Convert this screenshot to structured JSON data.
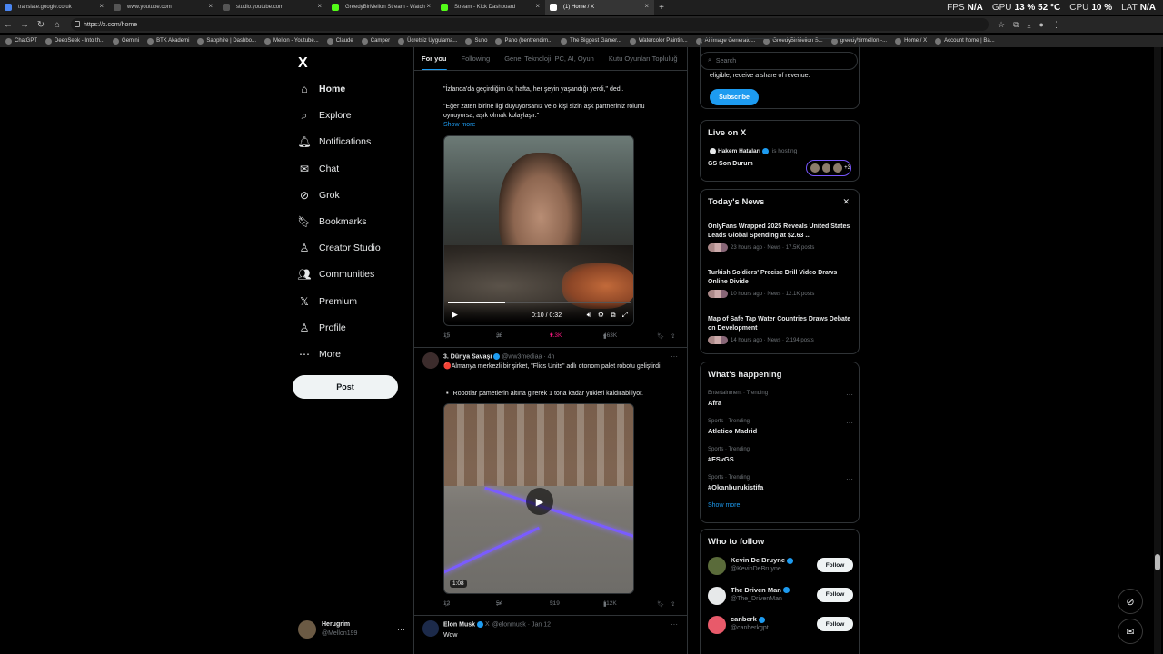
{
  "browser": {
    "tabs": [
      {
        "label": "translate.google.co.uk",
        "fav": "#4a85f0"
      },
      {
        "label": "www.youtube.com",
        "fav": "#555"
      },
      {
        "label": "studio.youtube.com",
        "fav": "#555"
      },
      {
        "label": "GreedyBirMellon Stream - Watch",
        "fav": "#53fc18"
      },
      {
        "label": "Stream - Kick Dashboard",
        "fav": "#53fc18"
      },
      {
        "label": "(1) Home / X",
        "fav": "#ffffff"
      }
    ],
    "new_tab": "+",
    "url": "https://x.com/home",
    "perf": {
      "fps_label": "FPS",
      "fps_value": "N/A",
      "gpu_label": "GPU",
      "gpu_value": "13 %  52 °C",
      "cpu_label": "CPU",
      "cpu_value": "10 %",
      "lat_label": "LAT",
      "lat_value": "N/A"
    },
    "bookmarks": [
      "ChatGPT",
      "DeepSeek - Into th...",
      "Gemini",
      "BTK Akademi",
      "Sapphire | Dashbo...",
      "Mellon - Youtube...",
      "Claude",
      "Camper",
      "Ücretsiz Uygulama...",
      "Suno",
      "Pano (bentrendim...",
      "The Biggest Gamer...",
      "Watercolor Paintin...",
      "AI Image Generato...",
      "GreedyBirMellon S...",
      "greedybirmellon -...",
      "Home / X",
      "Account home | Ba..."
    ]
  },
  "nav": {
    "logo": "X",
    "items": [
      {
        "label": "Home",
        "icon": "home-icon"
      },
      {
        "label": "Explore",
        "icon": "search-icon"
      },
      {
        "label": "Notifications",
        "icon": "bell-icon"
      },
      {
        "label": "Chat",
        "icon": "mail-icon"
      },
      {
        "label": "Grok",
        "icon": "grok-icon"
      },
      {
        "label": "Bookmarks",
        "icon": "bookmark-icon"
      },
      {
        "label": "Creator Studio",
        "icon": "creator-icon"
      },
      {
        "label": "Communities",
        "icon": "communities-icon"
      },
      {
        "label": "Premium",
        "icon": "x-icon"
      },
      {
        "label": "Profile",
        "icon": "profile-icon"
      },
      {
        "label": "More",
        "icon": "more-icon"
      }
    ],
    "post_label": "Post",
    "account": {
      "name": "Herugrim",
      "handle": "@Mellon199"
    }
  },
  "feed": {
    "tabs": [
      "For you",
      "Following",
      "Genel Teknoloji, PC, AI, Oyun",
      "Kutu Oyunları Topluluğ"
    ],
    "post1": {
      "text1": "\"İzlanda'da geçirdiğim üç hafta, her şeyin yaşandığı yerdi,\" dedi.",
      "text2": "\"Eğer zaten birine ilgi duyuyorsanız ve o kişi sizin aşk partneriniz rolünü oynuyorsa, aşık olmak kolaylaşır.\"",
      "show_more": "Show more",
      "video_time": "0:10 / 0:32",
      "video_progress": 0.31,
      "replies": "15",
      "reposts": "36",
      "likes": "1.3K",
      "views": "463K"
    },
    "post2": {
      "name": "3. Dünya Savaşı",
      "handle": "@ww3mediaa",
      "time": "4h",
      "text1": "🔴Almanya merkezli bir şirket, \"Flics Units\" adlı otonom palet robotu geliştirdi.",
      "text2": "▫️ Robotlar pametlerin altına girerek 1 tona kadar yükleri kaldırabiliyor.",
      "duration": "1:08",
      "replies": "12",
      "reposts": "54",
      "likes": "519",
      "views": "112K"
    },
    "post3": {
      "name": "Elon Musk",
      "badge": "X",
      "handle": "@elonmusk",
      "time": "Jan 12",
      "text": "Wow"
    }
  },
  "right": {
    "search_placeholder": "Search",
    "premium_text": "eligible, receive a share of revenue.",
    "subscribe": "Subscribe",
    "live": {
      "title": "Live on X",
      "host": "Hakem Hataları",
      "hosting": "is hosting",
      "stream_title": "GS Son Durum",
      "extra": "+3"
    },
    "news": {
      "title": "Today's News",
      "items": [
        {
          "title": "OnlyFans Wrapped 2025 Reveals United States Leads Global Spending at $2.63 ...",
          "meta": "23 hours ago · News · 17.5K posts"
        },
        {
          "title": "Turkish Soldiers' Precise Drill Video Draws Online Divide",
          "meta": "10 hours ago · News · 12.1K posts"
        },
        {
          "title": "Map of Safe Tap Water Countries Draws Debate on Development",
          "meta": "14 hours ago · News · 2,194 posts"
        }
      ]
    },
    "happening": {
      "title": "What's happening",
      "items": [
        {
          "category": "Entertainment · Trending",
          "name": "Afra"
        },
        {
          "category": "Sports · Trending",
          "name": "Atletico Madrid"
        },
        {
          "category": "Sports · Trending",
          "name": "#FSvGS"
        },
        {
          "category": "Sports · Trending",
          "name": "#Okanburukistifa"
        }
      ],
      "show_more": "Show more"
    },
    "follow": {
      "title": "Who to follow",
      "button": "Follow",
      "items": [
        {
          "name": "Kevin De Bruyne",
          "handle": "@KevinDeBruyne"
        },
        {
          "name": "The Driven Man",
          "handle": "@The_DrivenMan"
        },
        {
          "name": "canberk",
          "handle": "@canberkgpt"
        }
      ]
    }
  },
  "colors": {
    "accent": "#1d9bf0",
    "like": "#f91880",
    "bg": "#000000",
    "border": "#2f3336"
  }
}
